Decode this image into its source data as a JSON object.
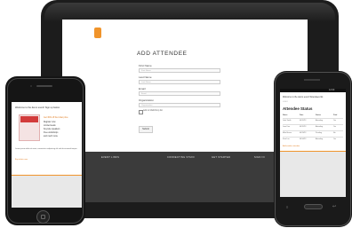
{
  "tablet": {
    "logo_text": "",
    "page_title": "ADD ATTENDEE",
    "fields": [
      {
        "label": "First Name",
        "placeholder": "First Name"
      },
      {
        "label": "Last Name",
        "placeholder": "Last Name"
      },
      {
        "label": "Email",
        "placeholder": "Email"
      },
      {
        "label": "Organization",
        "placeholder": "Organization"
      }
    ],
    "checkbox_label": "Add to Mailchimp list",
    "submit_label": "Submit",
    "footer_links": [
      "EVENT LINKS",
      "CONNECTING STUFF",
      "GET STARTED",
      "SIGN IN"
    ]
  },
  "iphone": {
    "header": "Welcome to the demo event! Sign up below",
    "ad_lines": [
      {
        "text": "Get 30% off the ticket price",
        "accent": true
      },
      {
        "text": "Register now",
        "accent": false
      },
      {
        "text": "Limited seats",
        "accent": false
      },
      {
        "text": "Keynote speakers",
        "accent": false
      },
      {
        "text": "Free workshops",
        "accent": false
      },
      {
        "text": "and much more",
        "accent": false
      }
    ],
    "paragraph": "Lorem ipsum dolor sit amet, consectetur adipiscing elit sed do eiusmod tempor",
    "link": "Buy tickets now"
  },
  "android": {
    "status_time": "12:00",
    "header": "Welcome to the demo event! Attendees list",
    "logo_text": "LOGO",
    "title": "Attendee Status",
    "columns": [
      "Name",
      "Date",
      "Status",
      "Paid"
    ],
    "rows": [
      [
        "John Smith",
        "04/12/13",
        "Attending",
        "Yes"
      ],
      [
        "Jane Doe",
        "04/12/13",
        "Attending",
        "Yes"
      ],
      [
        "Mike Brown",
        "04/13/13",
        "Pending",
        "No"
      ],
      [
        "Sara Lee",
        "04/14/13",
        "Attending",
        "Yes"
      ]
    ],
    "link": "Add another attendee"
  },
  "colors": {
    "accent": "#f0942b",
    "device_body": "#1c1c1c",
    "footer": "#3b3b3b"
  }
}
